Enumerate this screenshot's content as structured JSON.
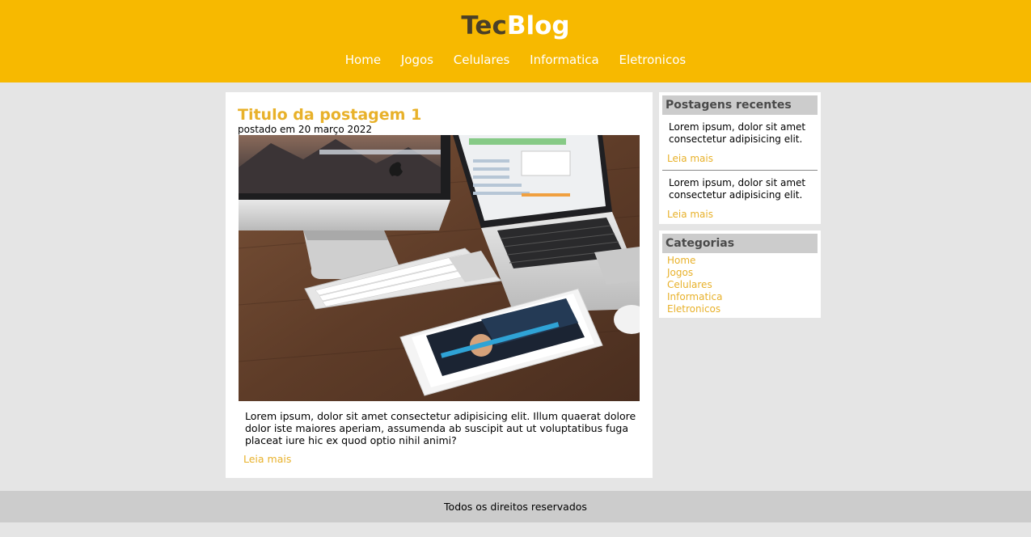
{
  "header": {
    "logo_part1": "Tec",
    "logo_part2": "Blog",
    "nav": [
      "Home",
      "Jogos",
      "Celulares",
      "Informatica",
      "Eletronicos"
    ]
  },
  "post": {
    "title": "Titulo da postagem 1",
    "date": "postado em 20 março 2022",
    "body": "Lorem ipsum, dolor sit amet consectetur adipisicing elit. Illum quaerat dolore dolor iste maiores aperiam, assumenda ab suscipit aut ut voluptatibus fuga placeat iure hic ex quod optio nihil animi?",
    "read_more": "Leia mais"
  },
  "sidebar": {
    "recent": {
      "title": "Postagens recentes",
      "items": [
        {
          "text": "Lorem ipsum, dolor sit amet consectetur adipisicing elit.",
          "link": "Leia mais"
        },
        {
          "text": "Lorem ipsum, dolor sit amet consectetur adipisicing elit.",
          "link": "Leia mais"
        }
      ]
    },
    "categories": {
      "title": "Categorias",
      "items": [
        "Home",
        "Jogos",
        "Celulares",
        "Informatica",
        "Eletronicos"
      ]
    }
  },
  "footer": {
    "text": "Todos os direitos reservados"
  },
  "colors": {
    "header_bg": "#f7b900",
    "accent": "#e8b12a",
    "page_bg": "#e5e5e5",
    "footer_bg": "#cccccc"
  }
}
